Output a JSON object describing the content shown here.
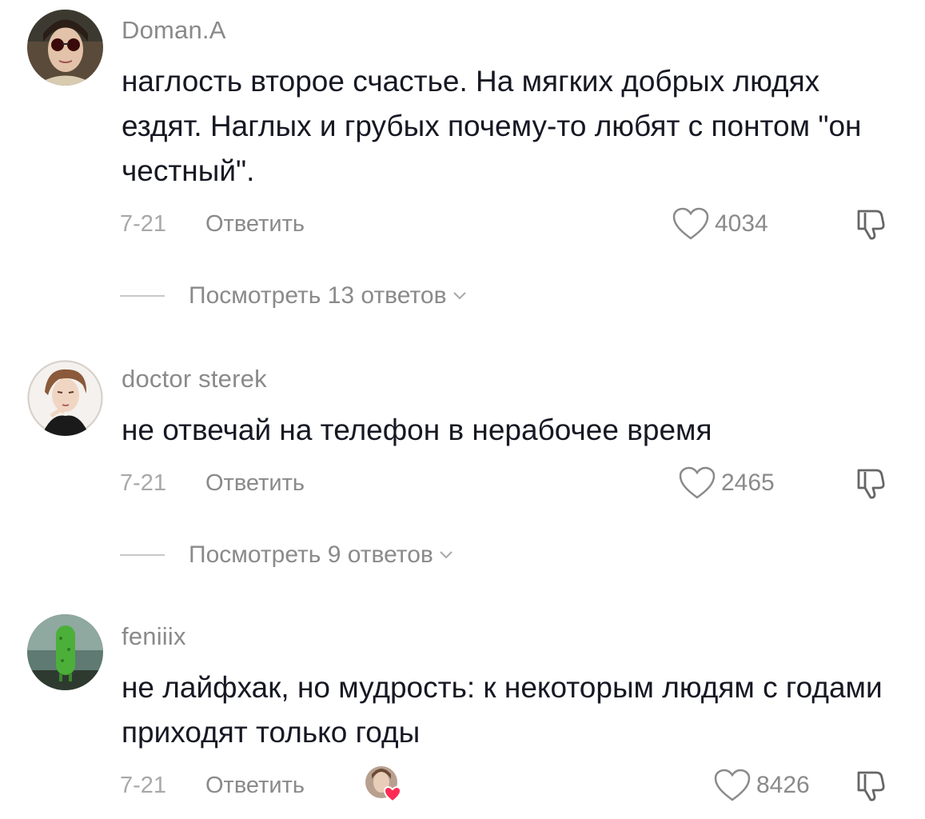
{
  "comments": [
    {
      "username": "Doman.A",
      "avatar_icon": "avatar-sunglasses",
      "text": "наглость второе счастье. На мягких добрых людях ездят. Наглых и грубых почему-то любят с понтом \"он честный\".",
      "date": "7-21",
      "reply_label": "Ответить",
      "likes": "4034",
      "view_replies": "Посмотреть 13 ответов"
    },
    {
      "username": "doctor sterek",
      "avatar_icon": "avatar-drawn-character",
      "text": "не отвечай на телефон в нерабочее время",
      "date": "7-21",
      "reply_label": "Ответить",
      "likes": "2465",
      "view_replies": "Посмотреть 9 ответов"
    },
    {
      "username": "feniiix",
      "avatar_icon": "avatar-cucumber",
      "text": "не лайфхак, но мудрость: к некоторым людям с годами приходят только годы",
      "date": "7-21",
      "reply_label": "Ответить",
      "likes": "8426",
      "creator_liked": true
    }
  ],
  "colors": {
    "text": "#161823",
    "secondary": "#8a8a8a",
    "date": "#a8a8a8",
    "heart_badge": "#fe2c55"
  }
}
